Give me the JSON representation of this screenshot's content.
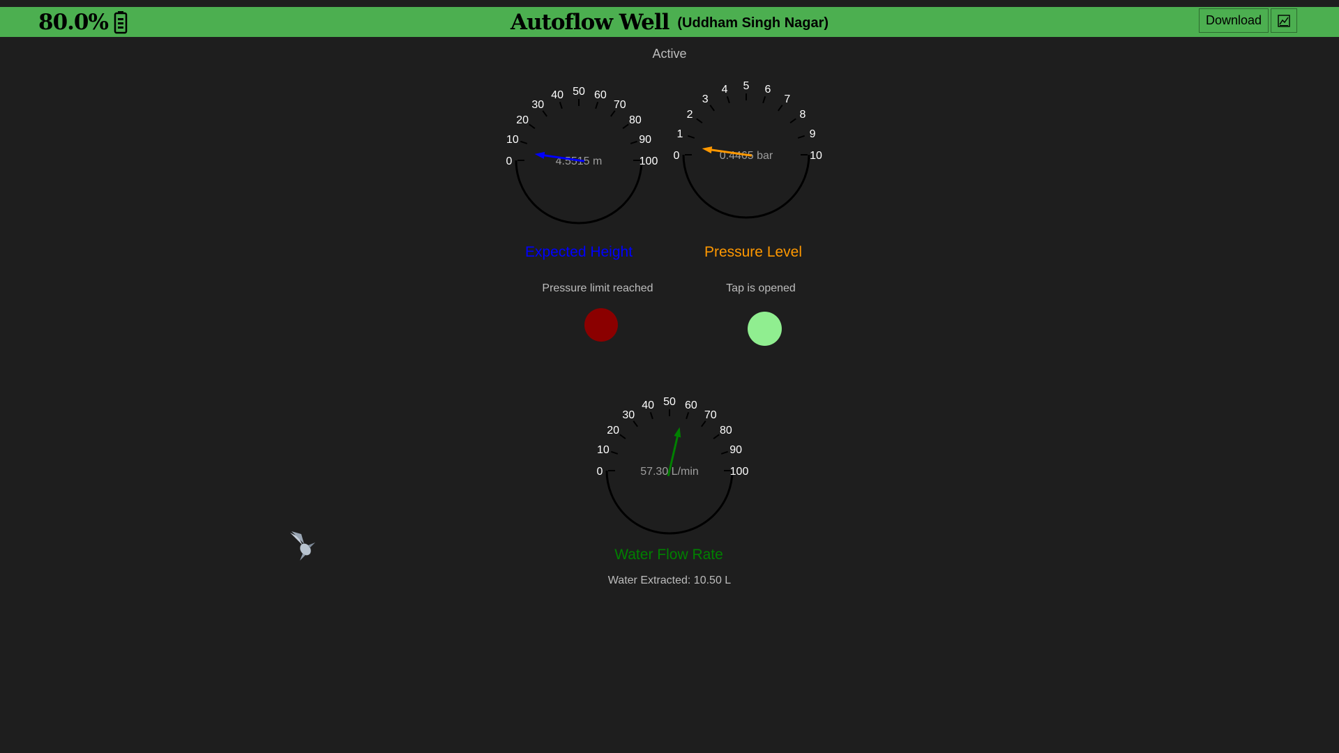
{
  "header": {
    "battery_percent": "80.0%",
    "title": "Autoflow Well",
    "location": "(Uddham Singh Nagar)",
    "download_label": "Download",
    "chart_icon": "chart-icon",
    "battery_icon": "battery-icon",
    "bg_color": "#4caf50"
  },
  "status": "Active",
  "gauges": [
    {
      "key": "height",
      "title": "Expected Height",
      "color": "#0000ff",
      "min": 0,
      "max": 100,
      "ticks": [
        "0",
        "10",
        "20",
        "30",
        "40",
        "50",
        "60",
        "70",
        "80",
        "90",
        "100"
      ],
      "value": 4.5515,
      "readout": "4.5515 m"
    },
    {
      "key": "pressure",
      "title": "Pressure Level",
      "color": "#ff9800",
      "min": 0,
      "max": 10,
      "ticks": [
        "0",
        "1",
        "2",
        "3",
        "4",
        "5",
        "6",
        "7",
        "8",
        "9",
        "10"
      ],
      "value": 0.4465,
      "readout": "0.4465 bar"
    },
    {
      "key": "flow",
      "title": "Water Flow Rate",
      "color": "#008000",
      "min": 0,
      "max": 100,
      "ticks": [
        "0",
        "10",
        "20",
        "30",
        "40",
        "50",
        "60",
        "70",
        "80",
        "90",
        "100"
      ],
      "value": 57.3,
      "readout": "57.30 L/min"
    }
  ],
  "indicators": {
    "pressure_limit": {
      "label": "Pressure limit reached",
      "color": "#8b0000"
    },
    "tap": {
      "label": "Tap is opened",
      "color": "#90ee90"
    }
  },
  "water_extracted": "Water Extracted: 10.50 L",
  "decor": {
    "bird_icon": "hummingbird-icon"
  }
}
